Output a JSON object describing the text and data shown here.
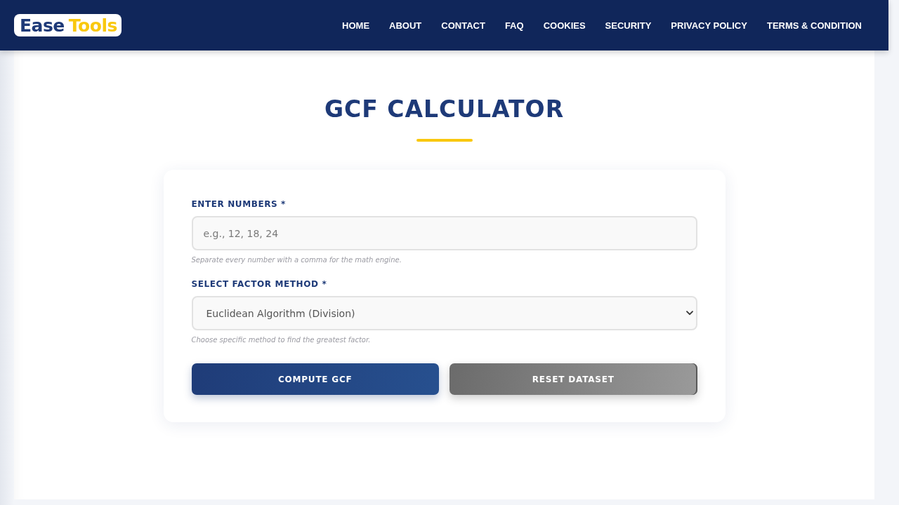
{
  "header": {
    "logo": {
      "part_1": "Ease",
      "part_2": "Tools"
    },
    "nav": [
      "HOME",
      "ABOUT",
      "CONTACT",
      "FAQ",
      "COOKIES",
      "SECURITY",
      "PRIVACY POLICY",
      "TERMS & CONDITION"
    ]
  },
  "page": {
    "title": "GCF CALCULATOR"
  },
  "form": {
    "fields": [
      {
        "kind": "text",
        "label": "ENTER NUMBERS *",
        "placeholder": "e.g., 12, 18, 24",
        "hint": "Separate every number with a comma for the math engine."
      },
      {
        "kind": "select",
        "label": "SELECT FACTOR METHOD *",
        "value": "Euclidean Algorithm (Division)",
        "hint": "Choose specific method to find the greatest factor."
      }
    ],
    "buttons": [
      {
        "kind": "primary",
        "label": "COMPUTE GCF"
      },
      {
        "kind": "secondary",
        "label": "RESET DATASET"
      }
    ]
  }
}
